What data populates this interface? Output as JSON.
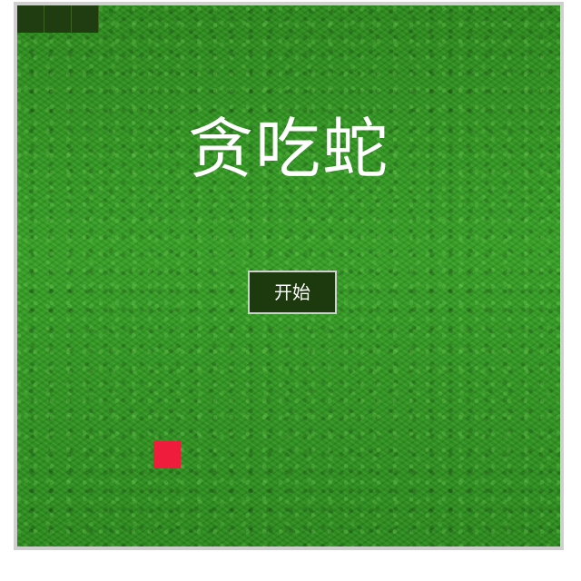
{
  "game": {
    "title": "贪吃蛇",
    "start_label": "开始"
  },
  "snake": {
    "segments": 3,
    "color": "#1f3d10"
  },
  "food": {
    "color": "#ef1c3b"
  },
  "colors": {
    "grass": "#2f8f1f",
    "border": "#cfcfcf",
    "button_bg": "#1d3a0f"
  }
}
